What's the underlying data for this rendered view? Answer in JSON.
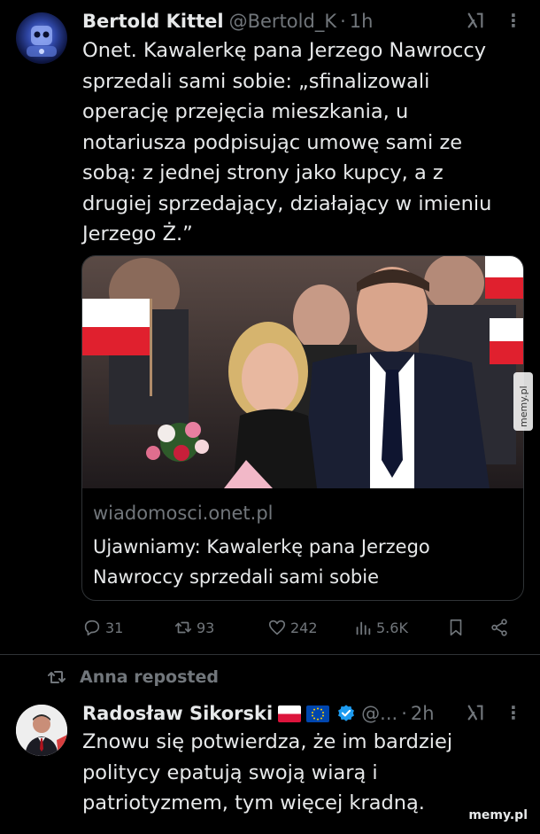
{
  "tweet1": {
    "author_name": "Bertold Kittel",
    "handle": "@Bertold_K",
    "separator": "·",
    "time": "1h",
    "text": "Onet. Kawalerkę pana Jerzego Nawroccy\nsprzedali sami sobie: „sfinalizowali\noperację przejęcia mieszkania, u\nnotariusza podpisując umowę sami ze\nsobą: z jednej strony jako kupcy, a z\ndrugiej sprzedający, działający w imieniu\nJerzego Ż.”",
    "card": {
      "domain": "wiadomosci.onet.pl",
      "title": "Ujawniamy: Kawalerkę pana Jerzego\nNawroccy sprzedali sami sobie"
    },
    "actions": {
      "replies": "31",
      "reposts": "93",
      "likes": "242",
      "views": "5.6K"
    }
  },
  "repost_label": "Anna reposted",
  "tweet2": {
    "author_name": "Radosław Sikorski",
    "handle": "@...",
    "separator": "·",
    "time": "2h",
    "text": "Znowu się potwierdza, że im bardziej\npolitycy epatują swoją wiarą i\npatriotyzmem, tym więcej kradną."
  },
  "watermark": "memy.pl",
  "side_watermark": "memy.pl",
  "colors": {
    "background": "#000000",
    "text": "#e7e9ea",
    "muted": "#71767b",
    "border": "#2f3336",
    "verified": "#1d9bf0"
  },
  "icons": [
    "grok-icon",
    "more-icon",
    "reply-icon",
    "repost-icon",
    "like-icon",
    "views-icon",
    "bookmark-icon",
    "share-icon",
    "verified-badge-icon"
  ]
}
